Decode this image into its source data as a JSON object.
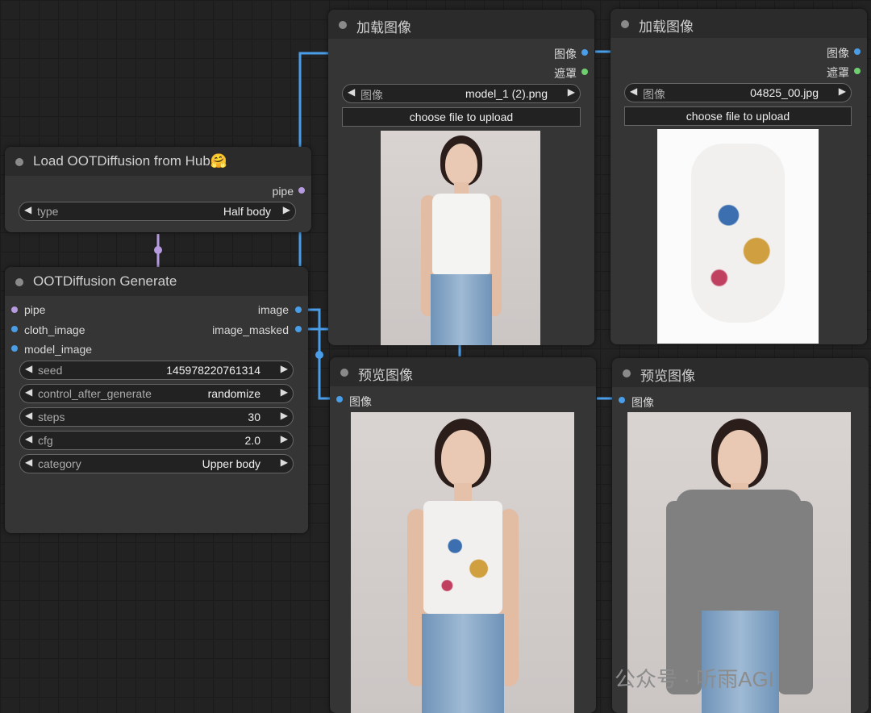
{
  "nodes": {
    "load_hub": {
      "title": "Load OOTDiffusion from Hub🤗",
      "output": "pipe",
      "widget": {
        "label": "type",
        "value": "Half body"
      }
    },
    "generate": {
      "title": "OOTDiffusion Generate",
      "inputs": [
        "pipe",
        "cloth_image",
        "model_image"
      ],
      "outputs": [
        "image",
        "image_masked"
      ],
      "widgets": [
        {
          "label": "seed",
          "value": "145978220761314"
        },
        {
          "label": "control_after_generate",
          "value": "randomize"
        },
        {
          "label": "steps",
          "value": "30"
        },
        {
          "label": "cfg",
          "value": "2.0"
        },
        {
          "label": "category",
          "value": "Upper body"
        }
      ]
    },
    "load_image_1": {
      "title": "加载图像",
      "outputs": [
        "图像",
        "遮罩"
      ],
      "widget": {
        "label": "图像",
        "value": "model_1 (2).png"
      },
      "upload_label": "choose file to upload"
    },
    "load_image_2": {
      "title": "加载图像",
      "outputs": [
        "图像",
        "遮罩"
      ],
      "widget": {
        "label": "图像",
        "value": "04825_00.jpg"
      },
      "upload_label": "choose file to upload"
    },
    "preview_1": {
      "title": "预览图像",
      "input": "图像"
    },
    "preview_2": {
      "title": "预览图像",
      "input": "图像"
    }
  },
  "watermark": "公众号 · 听雨AGI",
  "colors": {
    "link_image": "#4a9ee8",
    "link_pipe": "#b79be0",
    "mask_dot": "#6fcf6f",
    "canvas": "#222222",
    "node_body": "#353535"
  }
}
